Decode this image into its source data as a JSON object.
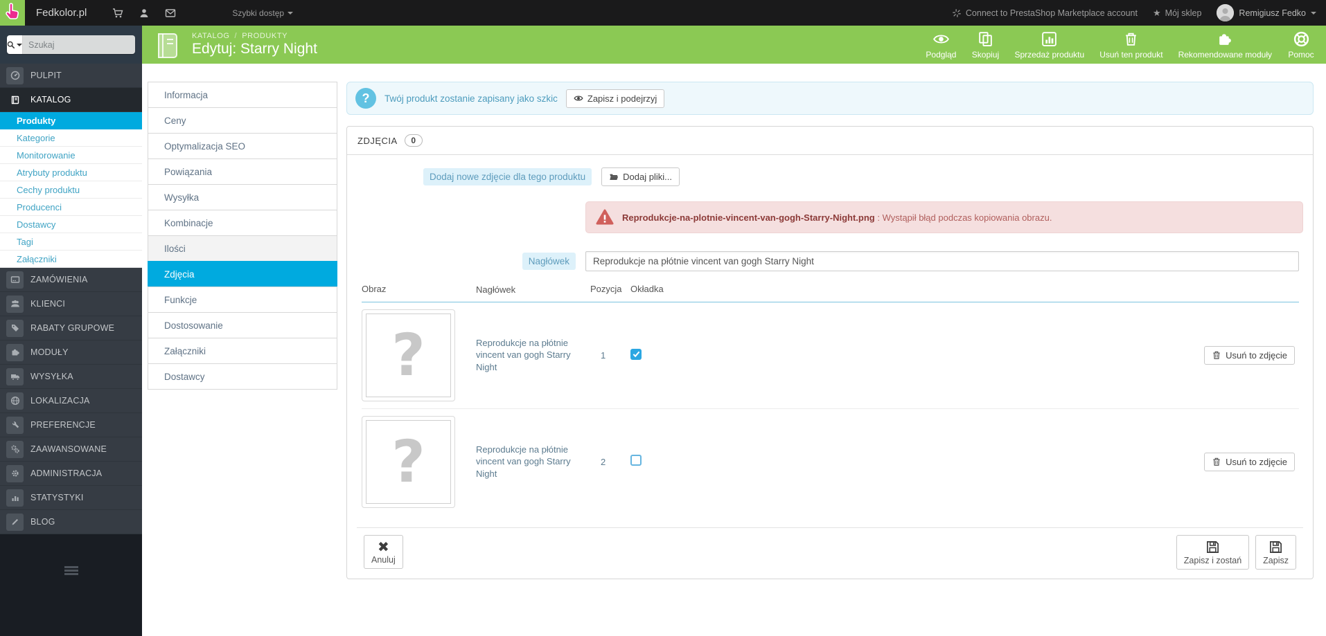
{
  "colors": {
    "accent_blue": "#00aadf",
    "header_green": "#8bc954",
    "topbar_bg": "#1a1a1b",
    "sidebar_bg": "#363c44",
    "error_bg": "#f5dfdf",
    "info_bg": "#eef8fc"
  },
  "topbar": {
    "brand": "Fedkolor.pl",
    "quick_access": "Szybki dostęp",
    "connect": "Connect to PrestaShop Marketplace account",
    "my_shop": "Mój sklep",
    "user_name": "Remigiusz Fedko"
  },
  "search": {
    "placeholder": "Szukaj"
  },
  "header": {
    "breadcrumb": {
      "section": "KATALOG",
      "separator": "/",
      "page": "PRODUKTY"
    },
    "title": "Edytuj: Starry Night",
    "actions": [
      {
        "label": "Podgląd"
      },
      {
        "label": "Skopiuj"
      },
      {
        "label": "Sprzedaż produktu"
      },
      {
        "label": "Usuń ten produkt"
      },
      {
        "label": "Rekomendowane moduły"
      },
      {
        "label": "Pomoc"
      }
    ]
  },
  "sidebar": {
    "items": [
      "PULPIT",
      "KATALOG",
      "ZAMÓWIENIA",
      "KLIENCI",
      "RABATY GRUPOWE",
      "MODUŁY",
      "WYSYŁKA",
      "LOKALIZACJA",
      "PREFERENCJE",
      "ZAAWANSOWANE",
      "ADMINISTRACJA",
      "STATYSTYKI",
      "BLOG"
    ],
    "submenu": [
      "Produkty",
      "Kategorie",
      "Monitorowanie",
      "Atrybuty produktu",
      "Cechy produktu",
      "Producenci",
      "Dostawcy",
      "Tagi",
      "Załączniki"
    ]
  },
  "tabs": {
    "items": [
      "Informacja",
      "Ceny",
      "Optymalizacja SEO",
      "Powiązania",
      "Wysyłka",
      "Kombinacje",
      "Ilości",
      "Zdjęcia",
      "Funkcje",
      "Dostosowanie",
      "Załączniki",
      "Dostawcy"
    ]
  },
  "draft_alert": {
    "text": "Twój produkt zostanie zapisany jako szkic",
    "button": "Zapisz i podejrzyj"
  },
  "panel": {
    "title": "ZDJĘCIA",
    "count": "0",
    "add_image_label": "Dodaj nowe zdjęcie dla tego produktu",
    "add_files_button": "Dodaj pliki..."
  },
  "error_alert": {
    "filename": "Reprodukcje-na-plotnie-vincent-van-gogh-Starry-Night.png",
    "separator": " : ",
    "message": "Wystąpił błąd podczas kopiowania obrazu."
  },
  "caption_field": {
    "label": "Nagłówek",
    "value": "Reprodukcje na płótnie vincent van gogh Starry Night"
  },
  "images_table": {
    "headers": [
      "Obraz",
      "Nagłówek",
      "Pozycja",
      "Okładka"
    ],
    "placeholder_glyph": "?",
    "rows": [
      {
        "caption": "Reprodukcje na płótnie vincent van gogh Starry Night",
        "position": "1",
        "cover": true,
        "delete_label": "Usuń to zdjęcie"
      },
      {
        "caption": "Reprodukcje na płótnie vincent van gogh Starry Night",
        "position": "2",
        "cover": false,
        "delete_label": "Usuń to zdjęcie"
      }
    ]
  },
  "footer": {
    "cancel": "Anuluj",
    "save_stay": "Zapisz i zostań",
    "save": "Zapisz"
  }
}
